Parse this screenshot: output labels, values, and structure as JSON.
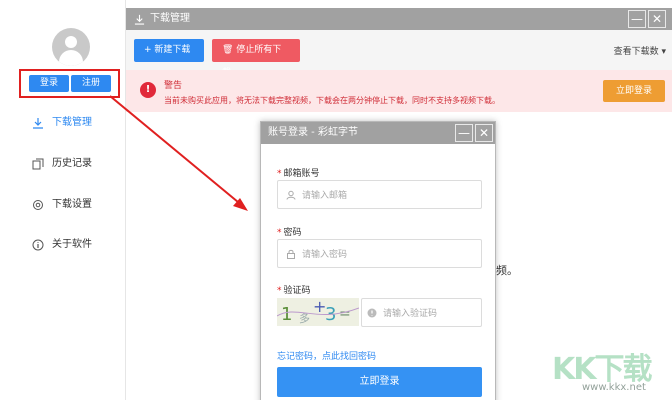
{
  "sidebar": {
    "login_label": "登录",
    "register_label": "注册",
    "items": [
      {
        "label": "下载管理",
        "icon": "download-icon"
      },
      {
        "label": "历史记录",
        "icon": "history-icon"
      },
      {
        "label": "下载设置",
        "icon": "gear-icon"
      },
      {
        "label": "关于软件",
        "icon": "info-icon"
      }
    ]
  },
  "header": {
    "title": "下载管理",
    "minimize": "—",
    "close": "✕"
  },
  "toolbar": {
    "new_download": "+ 新建下载",
    "stop_all": "停止所有下载",
    "view_downloads": "查看下载数"
  },
  "warning": {
    "title": "警告",
    "message": "当前未购买此应用，将无法下载完整视频，下载会在两分钟停止下载，同时不支持多视频下载。",
    "login_now": "立即登录"
  },
  "behind_text": "频。",
  "dialog": {
    "title": "账号登录 - 彩虹字节",
    "minimize": "—",
    "close": "✕",
    "email_label": "邮箱账号",
    "email_placeholder": "请输入邮箱",
    "password_label": "密码",
    "password_placeholder": "请输入密码",
    "captcha_label": "验证码",
    "captcha_placeholder": "请输入验证码",
    "forgot": "忘记密码，点此找回密码",
    "submit": "立即登录"
  },
  "watermark": {
    "brand": "KK下载",
    "url": "www.kkx.net"
  },
  "colors": {
    "accent": "#2e89f1",
    "danger": "#ef5a62",
    "warning_button": "#ee9d33",
    "highlight_box": "#e02020"
  }
}
